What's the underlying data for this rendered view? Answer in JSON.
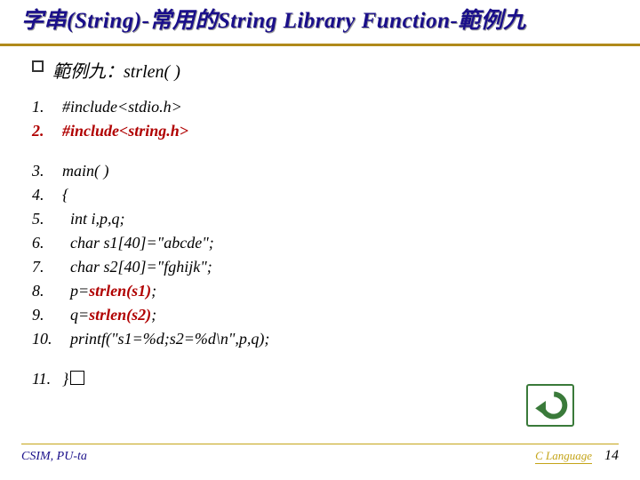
{
  "title": "字串(String)-常用的String Library Function-範例九",
  "subheading": {
    "label": "範例九：strlen( )"
  },
  "code": {
    "lines": [
      {
        "n": "1.",
        "text": "#include<stdio.h>",
        "red": false
      },
      {
        "n": "2.",
        "text": "#include<string.h>",
        "red": true
      },
      {
        "n": "3.",
        "text": "main( )",
        "red": false
      },
      {
        "n": "4.",
        "text": "{",
        "red": false
      },
      {
        "n": "5.",
        "text": "  int i,p,q;",
        "red": false
      },
      {
        "n": "6.",
        "text": "  char s1[40]=\"abcde\";",
        "red": false
      },
      {
        "n": "7.",
        "text": "  char s2[40]=\"fghijk\";",
        "red": false
      },
      {
        "n": "8.",
        "pre": "  p=",
        "mid": "strlen(s1)",
        "post": ";",
        "redpart": true
      },
      {
        "n": "9.",
        "pre": "  q=",
        "mid": "strlen(s2)",
        "post": ";",
        "redpart": true
      },
      {
        "n": "10.",
        "text": "  printf(\"s1=%d;s2=%d\\n\",p,q);",
        "red": false
      },
      {
        "n": "11.",
        "text": "}",
        "red": false,
        "tofu": true
      }
    ]
  },
  "footer": {
    "left": "CSIM, PU-ta",
    "right_label": "C Language",
    "page": "14"
  },
  "icons": {
    "back": "back-arrow-icon"
  }
}
